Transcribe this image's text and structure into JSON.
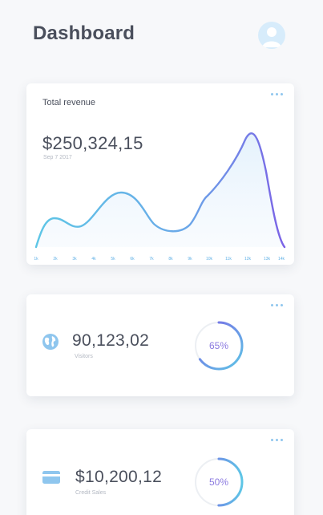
{
  "header": {
    "title": "Dashboard",
    "avatar_icon": "user-avatar-icon"
  },
  "revenue_card": {
    "title": "Total revenue",
    "value": "$250,324,15",
    "date": "Sep 7 2017",
    "menu_icon": "more-horizontal-icon",
    "x_ticks": [
      "1k",
      "2k",
      "3k",
      "4k",
      "5k",
      "6k",
      "7k",
      "8k",
      "9k",
      "10k",
      "11k",
      "12k",
      "13k",
      "14k"
    ],
    "colors": {
      "line_start": "#5ec6e6",
      "line_end": "#7b62e6",
      "fill": "#eaf5fd"
    }
  },
  "visitors_card": {
    "value": "90,123,02",
    "label": "Visitors",
    "percent_label": "65%",
    "percent": 65,
    "icon": "globe-icon",
    "menu_icon": "more-horizontal-icon"
  },
  "credit_card": {
    "value": "$10,200,12",
    "label": "Credit Sales",
    "percent_label": "50%",
    "percent": 50,
    "icon": "credit-card-icon",
    "menu_icon": "more-horizontal-icon"
  },
  "colors": {
    "accent_blue": "#5fb0e6",
    "accent_purple": "#7b62e6",
    "background": "#f7f8fa"
  }
}
